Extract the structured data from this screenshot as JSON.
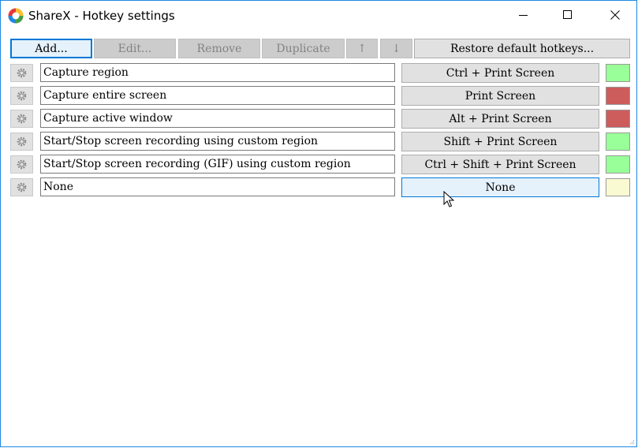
{
  "window": {
    "title": "ShareX - Hotkey settings"
  },
  "toolbar": {
    "add_label": "Add...",
    "edit_label": "Edit...",
    "remove_label": "Remove",
    "duplicate_label": "Duplicate",
    "move_up_label": "↑",
    "move_down_label": "↓",
    "restore_label": "Restore default hotkeys..."
  },
  "hotkeys": [
    {
      "description": "Capture region",
      "hotkey": "Ctrl + Print Screen",
      "status": "ok"
    },
    {
      "description": "Capture entire screen",
      "hotkey": "Print Screen",
      "status": "failed"
    },
    {
      "description": "Capture active window",
      "hotkey": "Alt + Print Screen",
      "status": "failed"
    },
    {
      "description": "Start/Stop screen recording using custom region",
      "hotkey": "Shift + Print Screen",
      "status": "ok"
    },
    {
      "description": "Start/Stop screen recording (GIF) using custom region",
      "hotkey": "Ctrl + Shift + Print Screen",
      "status": "ok"
    },
    {
      "description": "None",
      "hotkey": "None",
      "status": "not_configured"
    }
  ],
  "colors": {
    "status_ok": "#99ff99",
    "status_failed": "#cd5c5c",
    "status_not_configured": "#fafad2",
    "accent": "#0078d7"
  }
}
